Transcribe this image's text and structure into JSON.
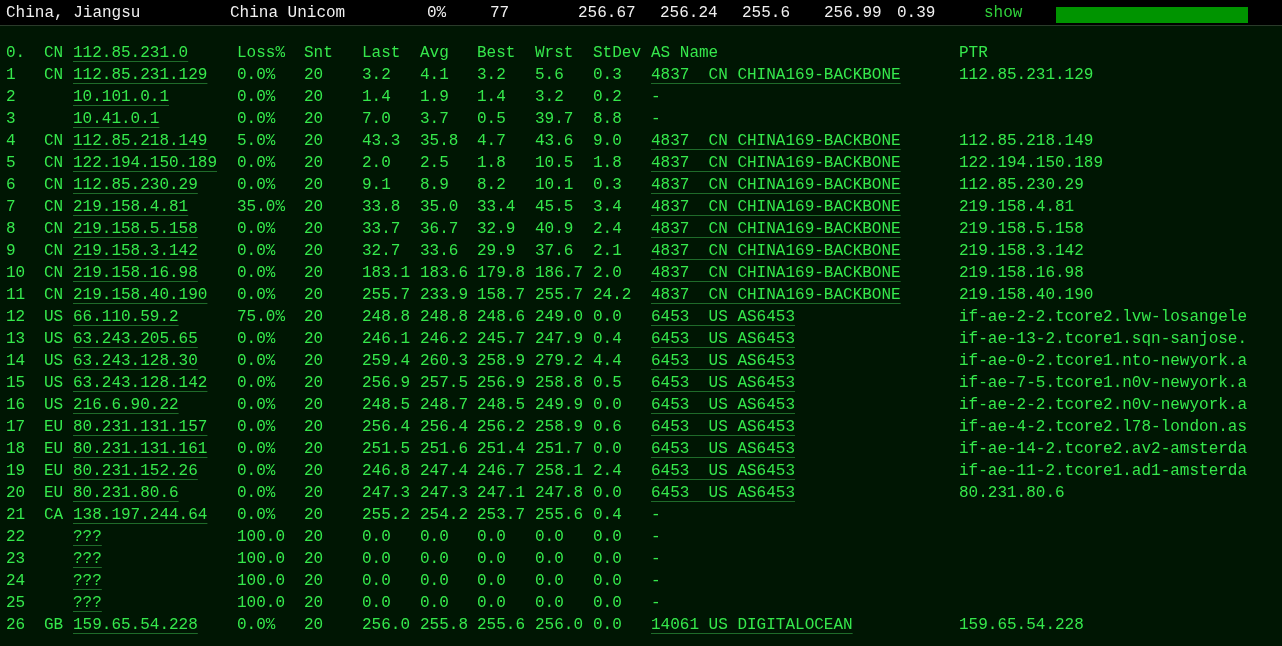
{
  "top_bar": {
    "location": "China, Jiangsu",
    "isp": "China Unicom",
    "loss": "0%",
    "count": "77",
    "values": [
      "256.67",
      "256.24",
      "255.6",
      "256.99",
      "0.39"
    ],
    "show_link": "show"
  },
  "header": {
    "hop": "0.",
    "cc": "CN",
    "ip": "112.85.231.0",
    "columns": [
      "Loss%",
      "Snt",
      "Last",
      "Avg",
      "Best",
      "Wrst",
      "StDev"
    ],
    "as_name": "AS Name",
    "ptr": "PTR"
  },
  "rows": [
    {
      "hop": "1",
      "cc": "CN",
      "ip": "112.85.231.129",
      "stats": [
        "0.0%",
        "20",
        "3.2",
        "4.1",
        "3.2",
        "5.6",
        "0.3"
      ],
      "as_name": "4837  CN CHINA169-BACKBONE",
      "as_link": true,
      "ptr": "112.85.231.129"
    },
    {
      "hop": "2",
      "cc": "",
      "ip": "10.101.0.1",
      "stats": [
        "0.0%",
        "20",
        "1.4",
        "1.9",
        "1.4",
        "3.2",
        "0.2"
      ],
      "as_name": "-",
      "as_link": false,
      "ptr": ""
    },
    {
      "hop": "3",
      "cc": "",
      "ip": "10.41.0.1",
      "stats": [
        "0.0%",
        "20",
        "7.0",
        "3.7",
        "0.5",
        "39.7",
        "8.8"
      ],
      "as_name": "-",
      "as_link": false,
      "ptr": ""
    },
    {
      "hop": "4",
      "cc": "CN",
      "ip": "112.85.218.149",
      "stats": [
        "5.0%",
        "20",
        "43.3",
        "35.8",
        "4.7",
        "43.6",
        "9.0"
      ],
      "as_name": "4837  CN CHINA169-BACKBONE",
      "as_link": true,
      "ptr": "112.85.218.149"
    },
    {
      "hop": "5",
      "cc": "CN",
      "ip": "122.194.150.189",
      "stats": [
        "0.0%",
        "20",
        "2.0",
        "2.5",
        "1.8",
        "10.5",
        "1.8"
      ],
      "as_name": "4837  CN CHINA169-BACKBONE",
      "as_link": true,
      "ptr": "122.194.150.189"
    },
    {
      "hop": "6",
      "cc": "CN",
      "ip": "112.85.230.29",
      "stats": [
        "0.0%",
        "20",
        "9.1",
        "8.9",
        "8.2",
        "10.1",
        "0.3"
      ],
      "as_name": "4837  CN CHINA169-BACKBONE",
      "as_link": true,
      "ptr": "112.85.230.29"
    },
    {
      "hop": "7",
      "cc": "CN",
      "ip": "219.158.4.81",
      "stats": [
        "35.0%",
        "20",
        "33.8",
        "35.0",
        "33.4",
        "45.5",
        "3.4"
      ],
      "as_name": "4837  CN CHINA169-BACKBONE",
      "as_link": true,
      "ptr": "219.158.4.81"
    },
    {
      "hop": "8",
      "cc": "CN",
      "ip": "219.158.5.158",
      "stats": [
        "0.0%",
        "20",
        "33.7",
        "36.7",
        "32.9",
        "40.9",
        "2.4"
      ],
      "as_name": "4837  CN CHINA169-BACKBONE",
      "as_link": true,
      "ptr": "219.158.5.158"
    },
    {
      "hop": "9",
      "cc": "CN",
      "ip": "219.158.3.142",
      "stats": [
        "0.0%",
        "20",
        "32.7",
        "33.6",
        "29.9",
        "37.6",
        "2.1"
      ],
      "as_name": "4837  CN CHINA169-BACKBONE",
      "as_link": true,
      "ptr": "219.158.3.142"
    },
    {
      "hop": "10",
      "cc": "CN",
      "ip": "219.158.16.98",
      "stats": [
        "0.0%",
        "20",
        "183.1",
        "183.6",
        "179.8",
        "186.7",
        "2.0"
      ],
      "as_name": "4837  CN CHINA169-BACKBONE",
      "as_link": true,
      "ptr": "219.158.16.98"
    },
    {
      "hop": "11",
      "cc": "CN",
      "ip": "219.158.40.190",
      "stats": [
        "0.0%",
        "20",
        "255.7",
        "233.9",
        "158.7",
        "255.7",
        "24.2"
      ],
      "as_name": "4837  CN CHINA169-BACKBONE",
      "as_link": true,
      "ptr": "219.158.40.190"
    },
    {
      "hop": "12",
      "cc": "US",
      "ip": "66.110.59.2",
      "stats": [
        "75.0%",
        "20",
        "248.8",
        "248.8",
        "248.6",
        "249.0",
        "0.0"
      ],
      "as_name": "6453  US AS6453",
      "as_link": true,
      "ptr": "if-ae-2-2.tcore2.lvw-losangele"
    },
    {
      "hop": "13",
      "cc": "US",
      "ip": "63.243.205.65",
      "stats": [
        "0.0%",
        "20",
        "246.1",
        "246.2",
        "245.7",
        "247.9",
        "0.4"
      ],
      "as_name": "6453  US AS6453",
      "as_link": true,
      "ptr": "if-ae-13-2.tcore1.sqn-sanjose."
    },
    {
      "hop": "14",
      "cc": "US",
      "ip": "63.243.128.30",
      "stats": [
        "0.0%",
        "20",
        "259.4",
        "260.3",
        "258.9",
        "279.2",
        "4.4"
      ],
      "as_name": "6453  US AS6453",
      "as_link": true,
      "ptr": "if-ae-0-2.tcore1.nto-newyork.a"
    },
    {
      "hop": "15",
      "cc": "US",
      "ip": "63.243.128.142",
      "stats": [
        "0.0%",
        "20",
        "256.9",
        "257.5",
        "256.9",
        "258.8",
        "0.5"
      ],
      "as_name": "6453  US AS6453",
      "as_link": true,
      "ptr": "if-ae-7-5.tcore1.n0v-newyork.a"
    },
    {
      "hop": "16",
      "cc": "US",
      "ip": "216.6.90.22",
      "stats": [
        "0.0%",
        "20",
        "248.5",
        "248.7",
        "248.5",
        "249.9",
        "0.0"
      ],
      "as_name": "6453  US AS6453",
      "as_link": true,
      "ptr": "if-ae-2-2.tcore2.n0v-newyork.a"
    },
    {
      "hop": "17",
      "cc": "EU",
      "ip": "80.231.131.157",
      "stats": [
        "0.0%",
        "20",
        "256.4",
        "256.4",
        "256.2",
        "258.9",
        "0.6"
      ],
      "as_name": "6453  US AS6453",
      "as_link": true,
      "ptr": "if-ae-4-2.tcore2.l78-london.as"
    },
    {
      "hop": "18",
      "cc": "EU",
      "ip": "80.231.131.161",
      "stats": [
        "0.0%",
        "20",
        "251.5",
        "251.6",
        "251.4",
        "251.7",
        "0.0"
      ],
      "as_name": "6453  US AS6453",
      "as_link": true,
      "ptr": "if-ae-14-2.tcore2.av2-amsterda"
    },
    {
      "hop": "19",
      "cc": "EU",
      "ip": "80.231.152.26",
      "stats": [
        "0.0%",
        "20",
        "246.8",
        "247.4",
        "246.7",
        "258.1",
        "2.4"
      ],
      "as_name": "6453  US AS6453",
      "as_link": true,
      "ptr": "if-ae-11-2.tcore1.ad1-amsterda"
    },
    {
      "hop": "20",
      "cc": "EU",
      "ip": "80.231.80.6",
      "stats": [
        "0.0%",
        "20",
        "247.3",
        "247.3",
        "247.1",
        "247.8",
        "0.0"
      ],
      "as_name": "6453  US AS6453",
      "as_link": true,
      "ptr": "80.231.80.6"
    },
    {
      "hop": "21",
      "cc": "CA",
      "ip": "138.197.244.64",
      "stats": [
        "0.0%",
        "20",
        "255.2",
        "254.2",
        "253.7",
        "255.6",
        "0.4"
      ],
      "as_name": "-",
      "as_link": false,
      "ptr": ""
    },
    {
      "hop": "22",
      "cc": "",
      "ip": "???",
      "stats": [
        "100.0",
        "20",
        "0.0",
        "0.0",
        "0.0",
        "0.0",
        "0.0"
      ],
      "as_name": "-",
      "as_link": false,
      "ptr": ""
    },
    {
      "hop": "23",
      "cc": "",
      "ip": "???",
      "stats": [
        "100.0",
        "20",
        "0.0",
        "0.0",
        "0.0",
        "0.0",
        "0.0"
      ],
      "as_name": "-",
      "as_link": false,
      "ptr": ""
    },
    {
      "hop": "24",
      "cc": "",
      "ip": "???",
      "stats": [
        "100.0",
        "20",
        "0.0",
        "0.0",
        "0.0",
        "0.0",
        "0.0"
      ],
      "as_name": "-",
      "as_link": false,
      "ptr": ""
    },
    {
      "hop": "25",
      "cc": "",
      "ip": "???",
      "stats": [
        "100.0",
        "20",
        "0.0",
        "0.0",
        "0.0",
        "0.0",
        "0.0"
      ],
      "as_name": "-",
      "as_link": false,
      "ptr": ""
    },
    {
      "hop": "26",
      "cc": "GB",
      "ip": "159.65.54.228",
      "stats": [
        "0.0%",
        "20",
        "256.0",
        "255.8",
        "255.6",
        "256.0",
        "0.0"
      ],
      "as_name": "14061 US DIGITALOCEAN",
      "as_link": true,
      "ptr": "159.65.54.228"
    }
  ]
}
